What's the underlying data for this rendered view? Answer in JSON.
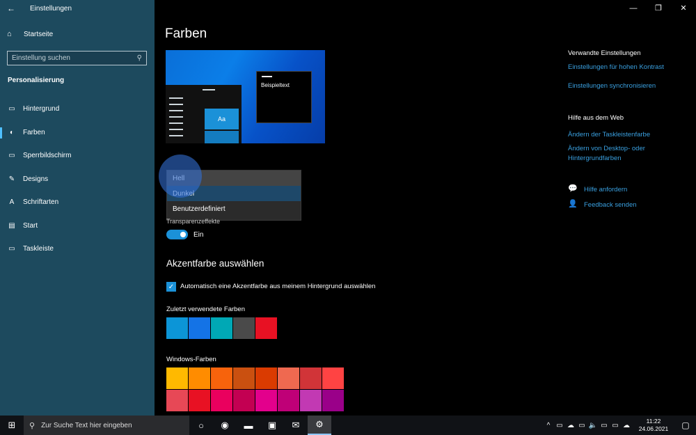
{
  "window": {
    "title": "Einstellungen",
    "controls": {
      "minimize": "—",
      "maximize": "❐",
      "close": "✕"
    }
  },
  "sidebar": {
    "back_icon": "←",
    "home": {
      "icon": "⌂",
      "label": "Startseite"
    },
    "search": {
      "placeholder": "Einstellung suchen",
      "icon": "⚲"
    },
    "section": "Personalisierung",
    "items": [
      {
        "icon": "▭",
        "label": "Hintergrund",
        "active": false
      },
      {
        "icon": "◐",
        "label": "Farben",
        "active": true
      },
      {
        "icon": "▭",
        "label": "Sperrbildschirm",
        "active": false
      },
      {
        "icon": "✎",
        "label": "Designs",
        "active": false
      },
      {
        "icon": "A",
        "label": "Schriftarten",
        "active": false
      },
      {
        "icon": "▤",
        "label": "Start",
        "active": false
      },
      {
        "icon": "▭",
        "label": "Taskleiste",
        "active": false
      }
    ]
  },
  "main": {
    "title": "Farben",
    "preview": {
      "aa": "Aa",
      "sample_text": "Beispieltext"
    },
    "mode_dropdown": {
      "options": [
        "Hell",
        "Dunkel",
        "Benutzerdefiniert"
      ],
      "hover": "Hell",
      "selected": "Dunkel"
    },
    "transparency": {
      "label": "Transparenzeffekte",
      "toggle_label": "Ein",
      "on": true
    },
    "accent": {
      "heading": "Akzentfarbe auswählen",
      "auto_check": "✓",
      "auto_label": "Automatisch eine Akzentfarbe aus meinem Hintergrund auswählen",
      "recent_label": "Zuletzt verwendete Farben",
      "recent_colors": [
        "#0c95d7",
        "#1473e6",
        "#00a8b5",
        "#4a4a4a",
        "#e81123"
      ],
      "windows_label": "Windows-Farben",
      "windows_colors": [
        "#ffb900",
        "#ff8c00",
        "#f7630c",
        "#ca5010",
        "#da3b01",
        "#ef6950",
        "#d13438",
        "#ff4343",
        "#e74856",
        "#e81123",
        "#ea005e",
        "#c30052",
        "#e3008c",
        "#bf0077",
        "#c239b3",
        "#9a0089"
      ]
    }
  },
  "related": {
    "heading": "Verwandte Einstellungen",
    "links": [
      "Einstellungen für hohen Kontrast",
      "Einstellungen synchronisieren"
    ]
  },
  "help": {
    "heading": "Hilfe aus dem Web",
    "links": [
      "Ändern der Taskleistenfarbe",
      "Ändern von Desktop- oder",
      "Hintergrundfarben"
    ],
    "actions": [
      {
        "icon": "💬",
        "label": "Hilfe anfordern"
      },
      {
        "icon": "👤",
        "label": "Feedback senden"
      }
    ]
  },
  "taskbar": {
    "start_icon": "⊞",
    "search_icon": "⚲",
    "search_placeholder": "Zur Suche Text hier eingeben",
    "apps": [
      {
        "name": "task-view-icon",
        "glyph": "○",
        "active": false
      },
      {
        "name": "edge-icon",
        "glyph": "◉",
        "active": false
      },
      {
        "name": "file-explorer-icon",
        "glyph": "▬",
        "active": false
      },
      {
        "name": "store-icon",
        "glyph": "▣",
        "active": false
      },
      {
        "name": "mail-icon",
        "glyph": "✉",
        "active": false
      },
      {
        "name": "settings-icon",
        "glyph": "⚙",
        "active": true
      }
    ],
    "tray_icons": [
      "^",
      "▭",
      "☁",
      "▭",
      "🔈",
      "▭",
      "▭",
      "☁"
    ],
    "time": "11:22",
    "date": "24.06.2021",
    "notification_icon": "▢"
  }
}
